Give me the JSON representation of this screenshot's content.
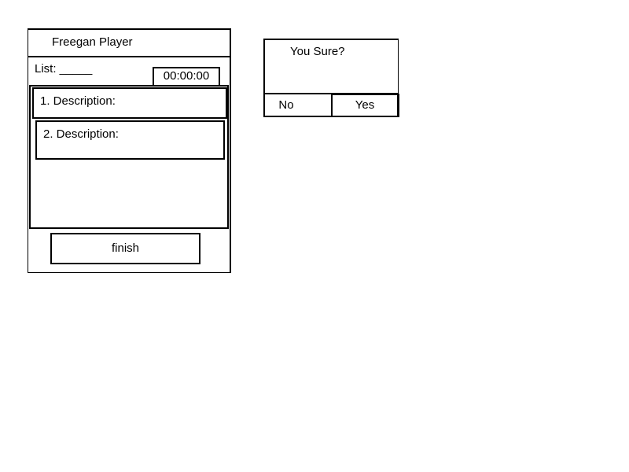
{
  "player": {
    "title": "Freegan Player",
    "list_label": "List: _____",
    "timer": "00:00:00",
    "items": [
      {
        "label": "1. Description:"
      },
      {
        "label": "2. Description:"
      }
    ],
    "finish_label": "finish"
  },
  "dialog": {
    "message": "You Sure?",
    "no_label": "No",
    "yes_label": "Yes"
  }
}
